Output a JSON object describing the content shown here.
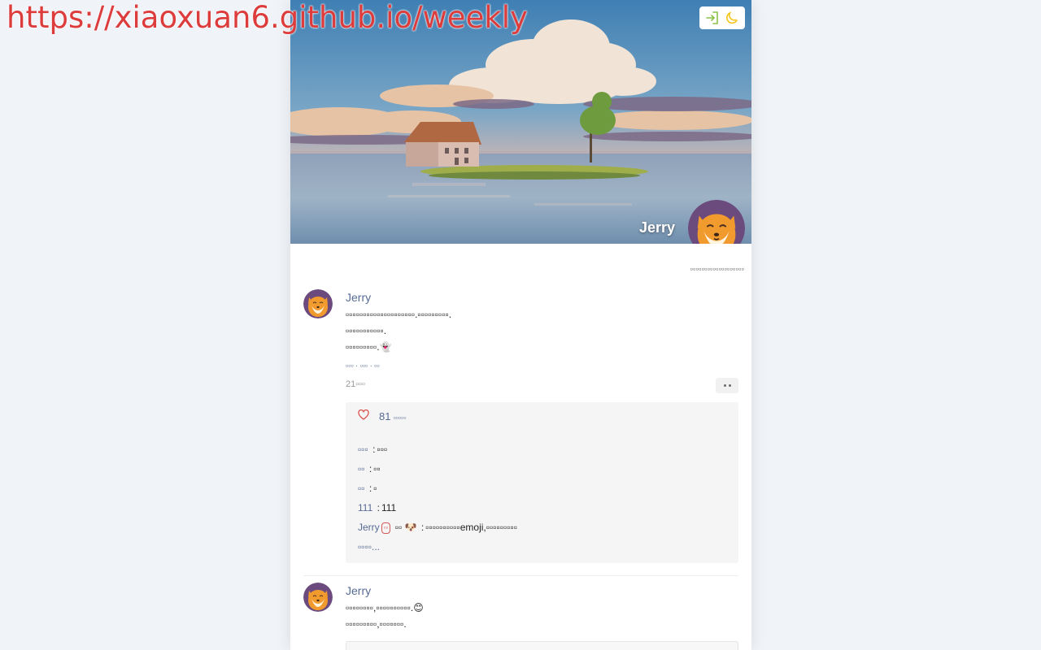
{
  "watermark": "https://xiaoxuan6.github.io/weekly",
  "header": {
    "login_icon": "login-arrow-icon",
    "theme_icon": "moon-icon",
    "user_name": "Jerry",
    "signature": "▫▫▫▫▫▫▫▫▫▫▫▫▫▫▫▫▫▫▫",
    "accent_color": "#8bc34a",
    "theme_color": "#f5c518"
  },
  "posts": [
    {
      "author": "Jerry",
      "lines": [
        "▫▫▫▫▫▫▫▫▫▫▫▫▫▫▫▫▫▫▫▫.▫▫▫▫▫▫▫▫▫.",
        "▫▫▫▫▫▫▫▫▫▫▫.",
        "▫▫▫▫▫▫▫▫▫.👻"
      ],
      "tags": [
        "▫▫▫",
        "▫▫▫",
        "▫▫"
      ],
      "tag_sep": "·",
      "time": "21▫▫▫",
      "likes": {
        "icon": "heart-outline-icon",
        "count": "81",
        "suffix": "▫▫▫▫▫"
      },
      "comments": [
        {
          "user": "▫▫▫",
          "sep": ":",
          "text": "▫▫▫"
        },
        {
          "user": "▫▫",
          "sep": ":",
          "text": "▫▫"
        },
        {
          "user": "▫▫",
          "sep": ":",
          "text": "▫"
        },
        {
          "user": "111",
          "sep": ":",
          "text": "111"
        },
        {
          "user": "Jerry",
          "badge": "▫▫",
          "reply_word": "▫▫",
          "reply_to": "🐶",
          "sep": ":",
          "text": "▫▫▫▫▫▫▫▫▫▫emoji,▫▫▫▫▫▫▫▫▫"
        }
      ],
      "see_more": "▫▫▫▫..."
    },
    {
      "author": "Jerry",
      "lines": [
        "▫▫▫▫▫▫▫▫,▫▫▫▫▫▫▫▫▫▫.😊",
        "▫▫▫▫▫▫▫▫▫,▫▫▫▫▫▫▫."
      ]
    }
  ]
}
